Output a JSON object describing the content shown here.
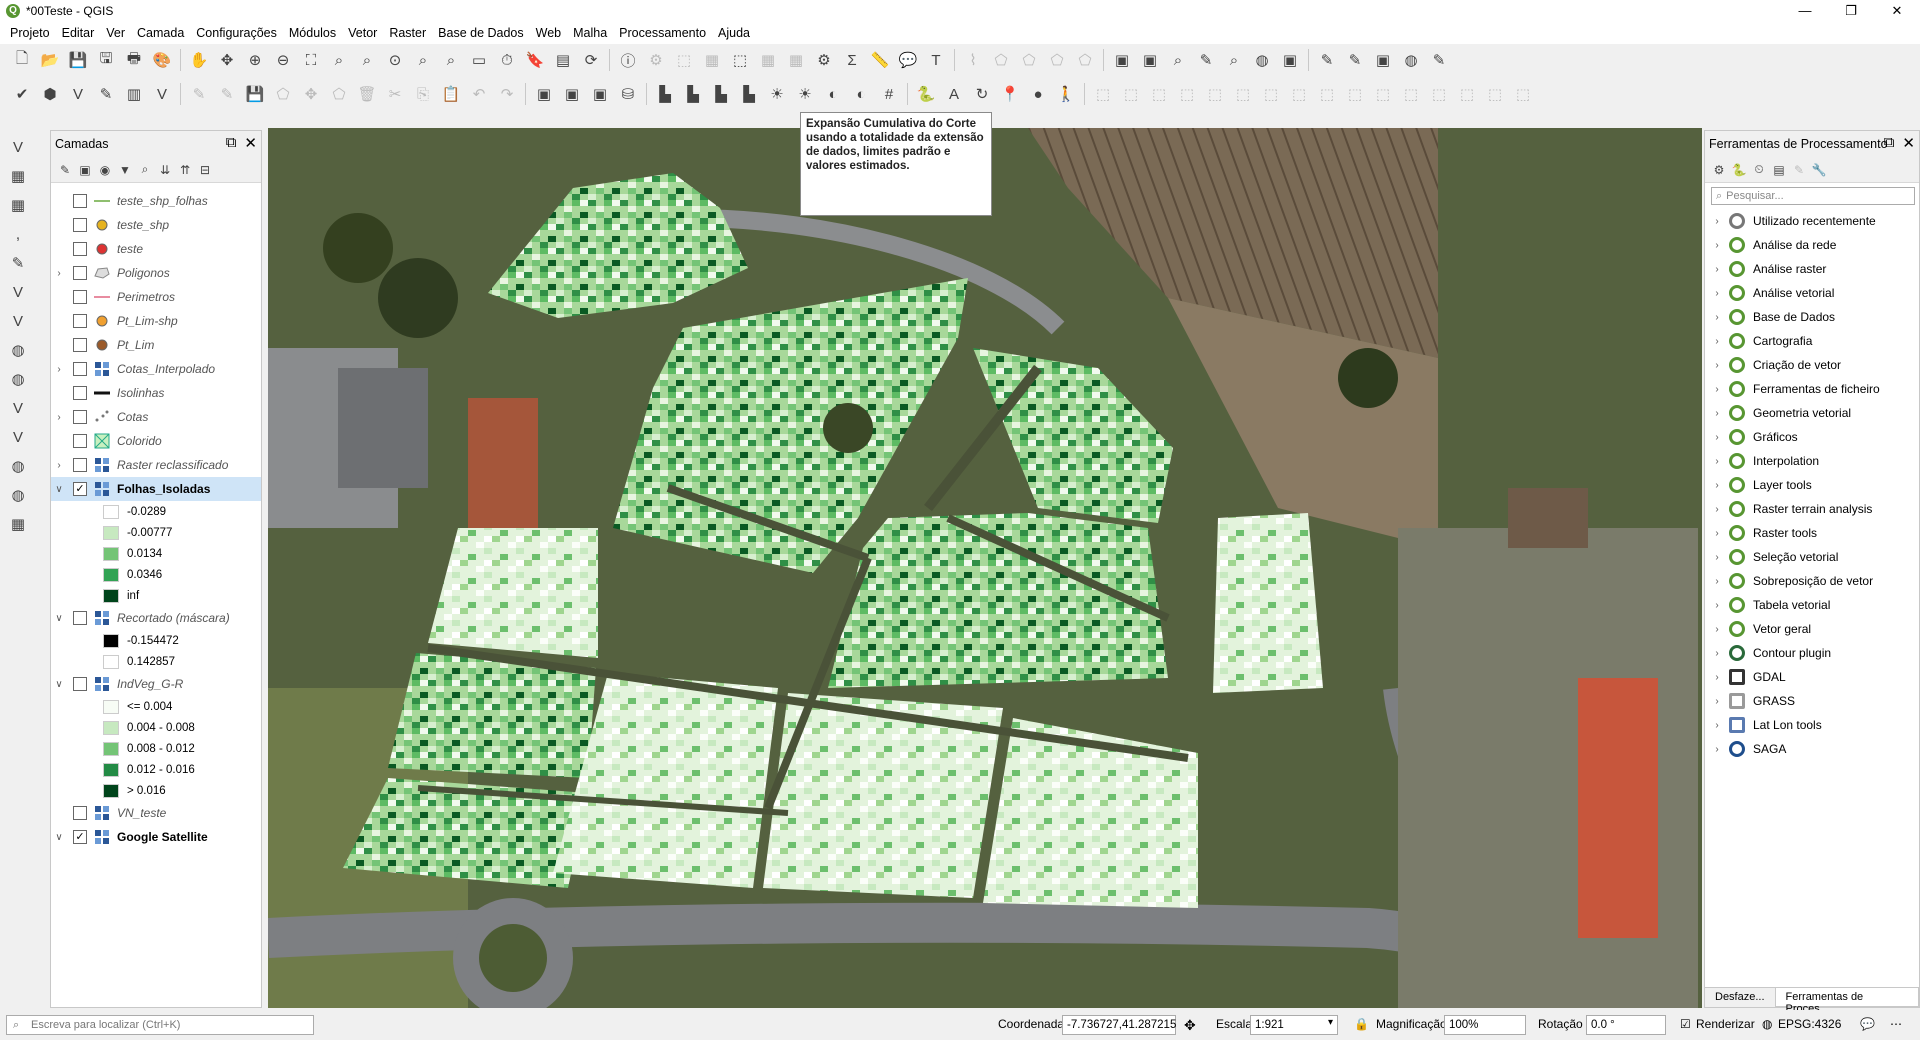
{
  "window": {
    "title": "*00Teste - QGIS",
    "app_icon": "Q",
    "minimize": "—",
    "maximize": "❐",
    "close": "✕"
  },
  "menu": [
    "Projeto",
    "Editar",
    "Ver",
    "Camada",
    "Configurações",
    "Módulos",
    "Vetor",
    "Raster",
    "Base de Dados",
    "Web",
    "Malha",
    "Processamento",
    "Ajuda"
  ],
  "tooltip": {
    "text": "Expansão Cumulativa do Corte usando a totalidade da extensão de dados, limites padrão e valores estimados."
  },
  "layers_panel": {
    "title": "Camadas",
    "layers": [
      {
        "name": "teste_shp_folhas",
        "icon": "line",
        "checked": false
      },
      {
        "name": "teste_shp",
        "icon": "point-yellow",
        "checked": false
      },
      {
        "name": "teste",
        "icon": "point-red",
        "checked": false
      },
      {
        "name": "Poligonos",
        "icon": "polygon",
        "checked": false
      },
      {
        "name": "Perimetros",
        "icon": "line-pink",
        "checked": false
      },
      {
        "name": "Pt_Lim-shp",
        "icon": "point-orange",
        "checked": false
      },
      {
        "name": "Pt_Lim",
        "icon": "point-brown",
        "checked": false
      },
      {
        "name": "Cotas_Interpolado",
        "icon": "raster",
        "checked": false
      },
      {
        "name": "Isolinhas",
        "icon": "line-black",
        "checked": false
      },
      {
        "name": "Cotas",
        "icon": "points",
        "checked": false
      },
      {
        "name": "Colorido",
        "icon": "polygon-green",
        "checked": false
      },
      {
        "name": "Raster reclassificado",
        "icon": "raster",
        "checked": false
      },
      {
        "name": "Folhas_Isoladas",
        "icon": "raster",
        "checked": true
      },
      {
        "name": "Recortado (máscara)",
        "icon": "raster",
        "checked": false
      },
      {
        "name": "IndVeg_G-R",
        "icon": "raster",
        "checked": false
      },
      {
        "name": "VN_teste",
        "icon": "raster",
        "checked": false
      },
      {
        "name": "Google Satellite",
        "icon": "raster",
        "checked": true
      }
    ],
    "legend_folhas": [
      {
        "label": "-0.0289",
        "color": "#ffffff"
      },
      {
        "label": "-0.00777",
        "color": "#c7e9c0"
      },
      {
        "label": "0.0134",
        "color": "#74c476"
      },
      {
        "label": "0.0346",
        "color": "#31a354"
      },
      {
        "label": "inf",
        "color": "#00441b"
      }
    ],
    "legend_recortado": [
      {
        "label": "-0.154472",
        "color": "#000000"
      },
      {
        "label": "0.142857",
        "color": "#ffffff"
      }
    ],
    "legend_indveg": [
      {
        "label": "<= 0.004",
        "color": "#f7fcf5"
      },
      {
        "label": "0.004 - 0.008",
        "color": "#c7e9c0"
      },
      {
        "label": "0.008 - 0.012",
        "color": "#74c476"
      },
      {
        "label": "0.012 - 0.016",
        "color": "#238b45"
      },
      {
        "label": "> 0.016",
        "color": "#00441b"
      }
    ]
  },
  "processing_panel": {
    "title": "Ferramentas de Processamento",
    "search_placeholder": "Pesquisar...",
    "items": [
      "Utilizado recentemente",
      "Análise da rede",
      "Análise raster",
      "Análise vetorial",
      "Base de Dados",
      "Cartografia",
      "Criação de vetor",
      "Ferramentas de ficheiro",
      "Geometria vetorial",
      "Gráficos",
      "Interpolation",
      "Layer tools",
      "Raster terrain analysis",
      "Raster tools",
      "Seleção vetorial",
      "Sobreposição de vetor",
      "Tabela vetorial",
      "Vetor geral",
      "Contour plugin",
      "GDAL",
      "GRASS",
      "Lat Lon tools",
      "SAGA"
    ],
    "tabs": [
      "Desfaze...",
      "Ferramentas de Proces..."
    ]
  },
  "status": {
    "locator_placeholder": "Escreva para localizar (Ctrl+K)",
    "coord_label": "Coordenada",
    "coord_value": "-7.736727,41.287215",
    "scale_label": "Escala",
    "scale_value": "1:921",
    "mag_label": "Magnificação",
    "mag_value": "100%",
    "rot_label": "Rotação",
    "rot_value": "0.0 °",
    "render_label": "Renderizar",
    "crs": "EPSG:4326"
  },
  "colors": {
    "accent": "#589632",
    "selection": "#cfe4f7"
  }
}
